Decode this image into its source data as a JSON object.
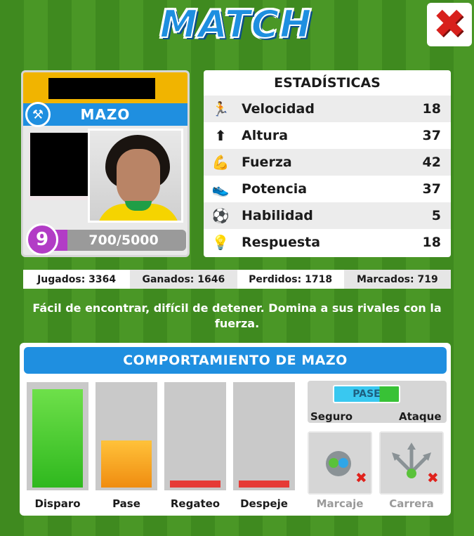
{
  "title": "MATCH",
  "close_icon": "close-x-icon",
  "player": {
    "role": "MAZO",
    "role_icon": "hammer-icon",
    "level": "9",
    "xp_text": "700/5000",
    "xp_progress": 0.14
  },
  "stats": {
    "title": "ESTADÍSTICAS",
    "rows": [
      {
        "label": "Velocidad",
        "value": "18",
        "icon": "running-icon",
        "glyph": "🏃"
      },
      {
        "label": "Altura",
        "value": "37",
        "icon": "arrow-up-icon",
        "glyph": "⬆"
      },
      {
        "label": "Fuerza",
        "value": "42",
        "icon": "muscle-icon",
        "glyph": "💪"
      },
      {
        "label": "Potencia",
        "value": "37",
        "icon": "boot-icon",
        "glyph": "👟"
      },
      {
        "label": "Habilidad",
        "value": "5",
        "icon": "ball-icon",
        "glyph": "⚽"
      },
      {
        "label": "Respuesta",
        "value": "18",
        "icon": "lightbulb-icon",
        "glyph": "💡"
      }
    ]
  },
  "record": {
    "played": "Jugados: 3364",
    "won": "Ganados: 1646",
    "lost": "Perdidos: 1718",
    "scored": "Marcados: 719"
  },
  "description": "Fácil de encontrar, difícil de detener. Domina a sus rivales con la fuerza.",
  "behaviour": {
    "title": "COMPORTAMIENTO DE MAZO",
    "bars": [
      {
        "label": "Disparo",
        "level": 0.96,
        "color": "#3fd22a"
      },
      {
        "label": "Pase",
        "level": 0.46,
        "color": "#f5a316"
      },
      {
        "label": "Regateo",
        "level": 0.06,
        "color": "#e63a36"
      },
      {
        "label": "Despeje",
        "level": 0.06,
        "color": "#e63a36"
      }
    ],
    "pase_slider": {
      "label": "PASE",
      "left": "Seguro",
      "right": "Ataque",
      "level": 0.7
    },
    "marcaje": "Marcaje",
    "carrera": "Carrera"
  }
}
